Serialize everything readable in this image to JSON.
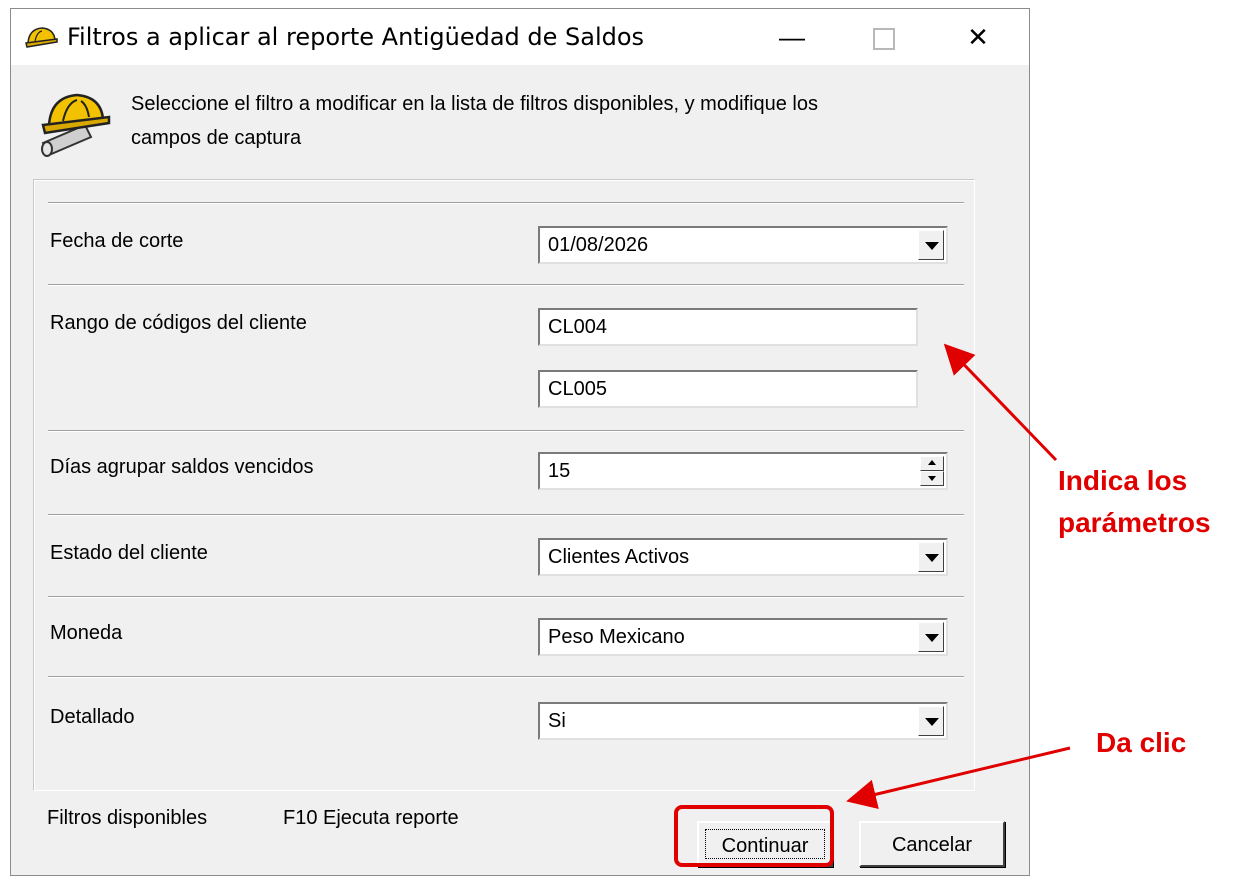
{
  "window": {
    "title": "Filtros a aplicar al reporte Antigüedad de Saldos",
    "controls": {
      "minimize": "—",
      "close": "✕"
    },
    "instruction": "Seleccione el filtro a modificar  en la lista de filtros disponibles, y modifique los campos de  captura"
  },
  "filters": {
    "fecha_corte": {
      "label": "Fecha de corte",
      "value": "01/08/2026"
    },
    "rango_codigos": {
      "label": "Rango de códigos del cliente",
      "from": "CL004",
      "to": "CL005"
    },
    "dias_agrupar": {
      "label": "Días agrupar saldos vencidos",
      "value": "15"
    },
    "estado_cliente": {
      "label": "Estado del cliente",
      "value": "Clientes Activos"
    },
    "moneda": {
      "label": "Moneda",
      "value": "Peso Mexicano"
    },
    "detallado": {
      "label": "Detallado",
      "value": "Si"
    }
  },
  "status": {
    "filtros_disponibles": "Filtros disponibles",
    "f10": "F10 Ejecuta reporte"
  },
  "buttons": {
    "continuar": "Continuar",
    "cancelar": "Cancelar"
  },
  "annotations": {
    "parametros_line1": "Indica los",
    "parametros_line2": "parámetros",
    "da_clic": "Da clic",
    "color": "#e00000"
  }
}
